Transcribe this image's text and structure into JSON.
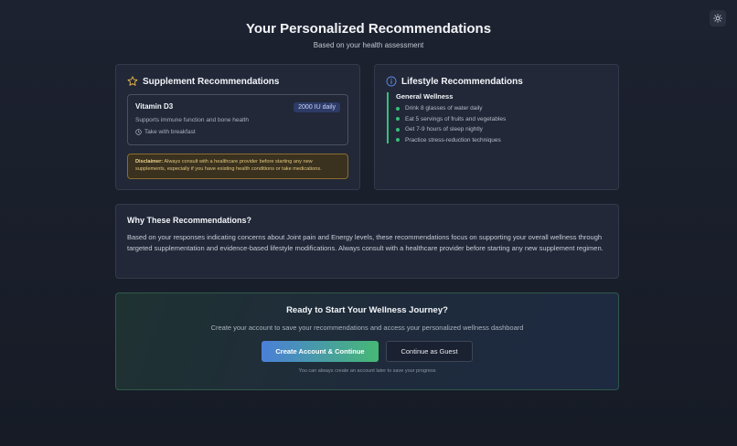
{
  "header": {
    "title": "Your Personalized Recommendations",
    "subtitle": "Based on your health assessment",
    "theme_icon": "sun-icon"
  },
  "supplements": {
    "title": "Supplement Recommendations",
    "icon": "star-icon",
    "items": [
      {
        "name": "Vitamin D3",
        "dose": "2000 IU daily",
        "description": "Supports immune function and bone health",
        "timing": "Take with breakfast",
        "timing_icon": "clock-icon"
      }
    ],
    "disclaimer_label": "Disclaimer:",
    "disclaimer_text": "Always consult with a healthcare provider before starting any new supplements, especially if you have existing health conditions or take medications."
  },
  "lifestyle": {
    "title": "Lifestyle Recommendations",
    "icon": "info-icon",
    "category": "General Wellness",
    "items": [
      "Drink 8 glasses of water daily",
      "Eat 5 servings of fruits and vegetables",
      "Get 7-9 hours of sleep nightly",
      "Practice stress-reduction techniques"
    ],
    "accent_color": "#35c07a"
  },
  "why": {
    "title": "Why These Recommendations?",
    "text": "Based on your responses indicating concerns about Joint pain and Energy levels, these recommendations focus on supporting your overall wellness through targeted supplementation and evidence-based lifestyle modifications. Always consult with a healthcare provider before starting any new supplement regimen."
  },
  "cta": {
    "title": "Ready to Start Your Wellness Journey?",
    "subtitle": "Create your account to save your recommendations and access your personalized wellness dashboard",
    "primary_label": "Create Account & Continue",
    "secondary_label": "Continue as Guest",
    "note": "You can always create an account later to save your progress"
  }
}
